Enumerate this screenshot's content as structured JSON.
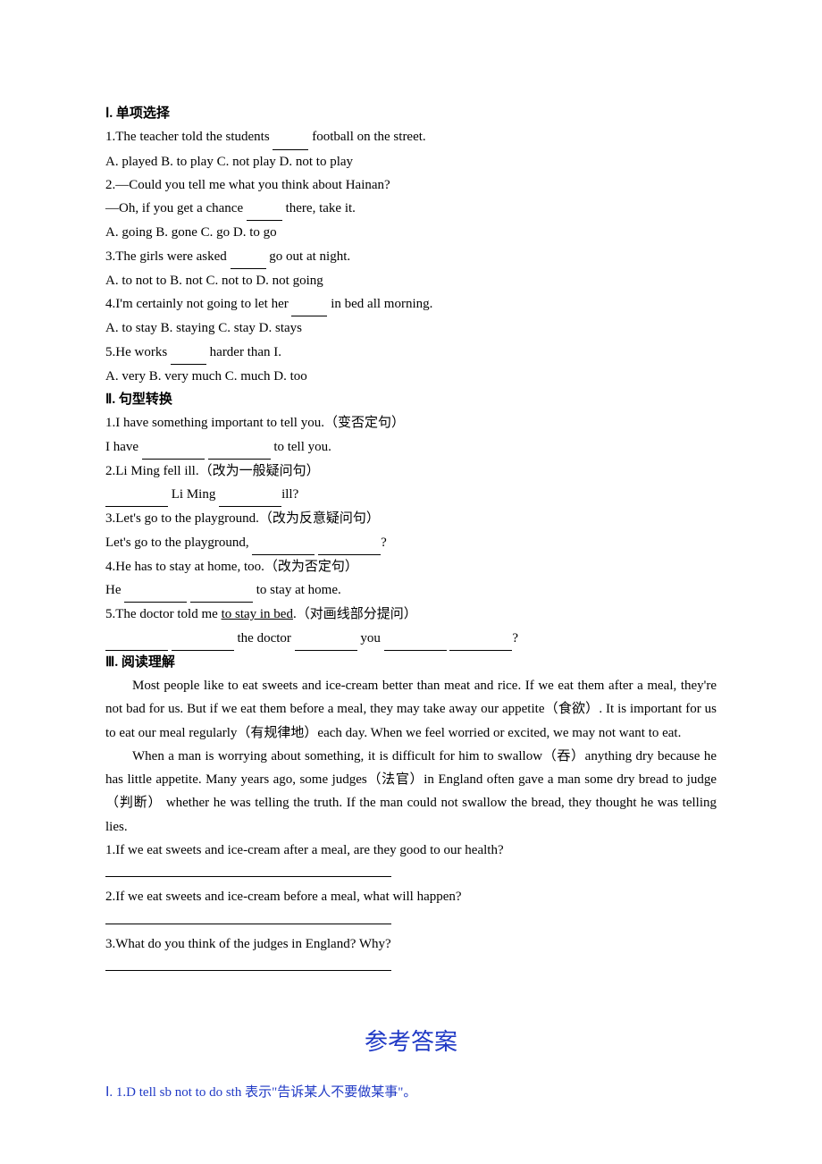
{
  "section1": {
    "heading": "Ⅰ. 单项选择",
    "q1": {
      "prompt": "1.The teacher told the students ____ football on the street.",
      "opts": "A. played    B. to play   C. not play  D. not to play"
    },
    "q2": {
      "l1": "2.—Could you tell me what you think about Hainan?",
      "l2": "—Oh, if you get a chance ____ there, take it.",
      "opts": "A. going    B. gone    C. go      D. to go"
    },
    "q3": {
      "prompt": "3.The girls were asked ____ go out at night.",
      "opts": "A. to not to  B. not     C. not to    D. not going"
    },
    "q4": {
      "prompt": "4.I'm certainly not going to let her ____ in bed all morning.",
      "opts": "A. to stay   B. staying   C. stay    D. stays"
    },
    "q5": {
      "prompt": "5.He works ____ harder than I.",
      "opts": "A. very    B. very much  C. much   D. too"
    }
  },
  "section2": {
    "heading": "Ⅱ. 句型转换",
    "q1": {
      "l1": "1.I have something important to tell you.（变否定句）",
      "l2a": "I have ",
      "l2b": " to tell you."
    },
    "q2": {
      "l1": "2.Li Ming fell ill.（改为一般疑问句）",
      "l2a": " Li Ming ",
      "l2b": "ill?"
    },
    "q3": {
      "l1": "3.Let's go to the playground.（改为反意疑问句）",
      "l2a": "Let's go to the playground, ",
      "l2b": "?"
    },
    "q4": {
      "l1": "4.He has to stay at home, too.（改为否定句）",
      "l2a": "He ",
      "l2b": " to stay at home."
    },
    "q5": {
      "l1_a": "5.The doctor told me ",
      "l1_u": "to stay in bed",
      "l1_b": ".（对画线部分提问）",
      "l2a": " the doctor ",
      "l2b": " you ",
      "l2c": "?"
    }
  },
  "section3": {
    "heading": "Ⅲ. 阅读理解",
    "p1": "Most people like to eat sweets and ice-cream better than meat and rice. If we eat them after a meal, they're not bad for us. But if we eat them before a meal, they may take away our appetite（食欲）. It is important for us to eat our meal regularly（有规律地）each day. When we feel worried or excited, we may not want to eat.",
    "p2": "When a man is worrying about something, it is difficult for him to swallow（吞）anything dry because he has little appetite. Many years ago, some judges（法官）in England often gave a man some dry bread to judge （判断） whether he was telling the truth. If the man could not swallow the bread, they thought he was telling lies.",
    "q1": "1.If we eat sweets and ice-cream after a meal, are they good to our health?",
    "q2": "2.If we eat sweets and ice-cream before a meal, what will happen?",
    "q3": "3.What do you think of the judges in England? Why?"
  },
  "answers": {
    "title": "参考答案",
    "line1": "Ⅰ. 1.D  tell sb not to do sth 表示\"告诉某人不要做某事\"。"
  }
}
